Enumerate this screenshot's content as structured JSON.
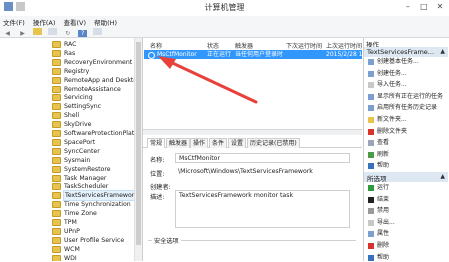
{
  "window": {
    "title": "计算机管理"
  },
  "menu": [
    "文件(F)",
    "操作(A)",
    "查看(V)",
    "帮助(H)"
  ],
  "tree": {
    "items": [
      "RAC",
      "Ras",
      "RecoveryEnvironment",
      "Registry",
      "RemoteApp and Desktop",
      "RemoteAssistance",
      "Servicing",
      "SettingSync",
      "Shell",
      "SkyDrive",
      "SoftwareProtectionPlatform",
      "SpacePort",
      "SyncCenter",
      "Sysmain",
      "SystemRestore",
      "Task Manager",
      "TaskScheduler",
      "TextServicesFramework",
      "Time Synchronization",
      "Time Zone",
      "TPM",
      "UPnP",
      "User Profile Service",
      "WCM",
      "WDI"
    ],
    "selected_index": 17
  },
  "tasks": {
    "columns": [
      "名称",
      "状态",
      "触发器",
      "下次运行时间",
      "上次运行时间"
    ],
    "rows": [
      {
        "name": "MsCtfMonitor",
        "status": "正在运行",
        "trigger": "当任何用户登录时",
        "next_run": "",
        "last_run": "2015/2/28 10:53"
      }
    ]
  },
  "detail": {
    "tabs": [
      "常规",
      "触发器",
      "操作",
      "条件",
      "设置",
      "历史记录(已禁用)"
    ],
    "fields": {
      "name_label": "名称:",
      "name_value": "MsCtfMonitor",
      "location_label": "位置:",
      "location_value": "\\Microsoft\\Windows\\TextServicesFramework",
      "author_label": "创建者:",
      "desc_label": "描述:",
      "desc_value": "TextServicesFramework monitor task",
      "security_label": "安全选项"
    }
  },
  "actions": {
    "header": "操作",
    "group1": "TextServicesFrame...",
    "items1": [
      "创建基本任务...",
      "创建任务...",
      "导入任务...",
      "显示所有正在运行的任务",
      "启用所有任务历史记录",
      "新文件夹...",
      "删除文件夹",
      "查看",
      "刷新",
      "帮助"
    ],
    "group2": "所选项",
    "items2": [
      "运行",
      "结束",
      "禁用",
      "导出...",
      "属性",
      "删除",
      "帮助"
    ]
  },
  "colors": {
    "selection": "#3297fd",
    "annotation_arrow": "#e8403a",
    "action_group": "#dde8f3"
  }
}
